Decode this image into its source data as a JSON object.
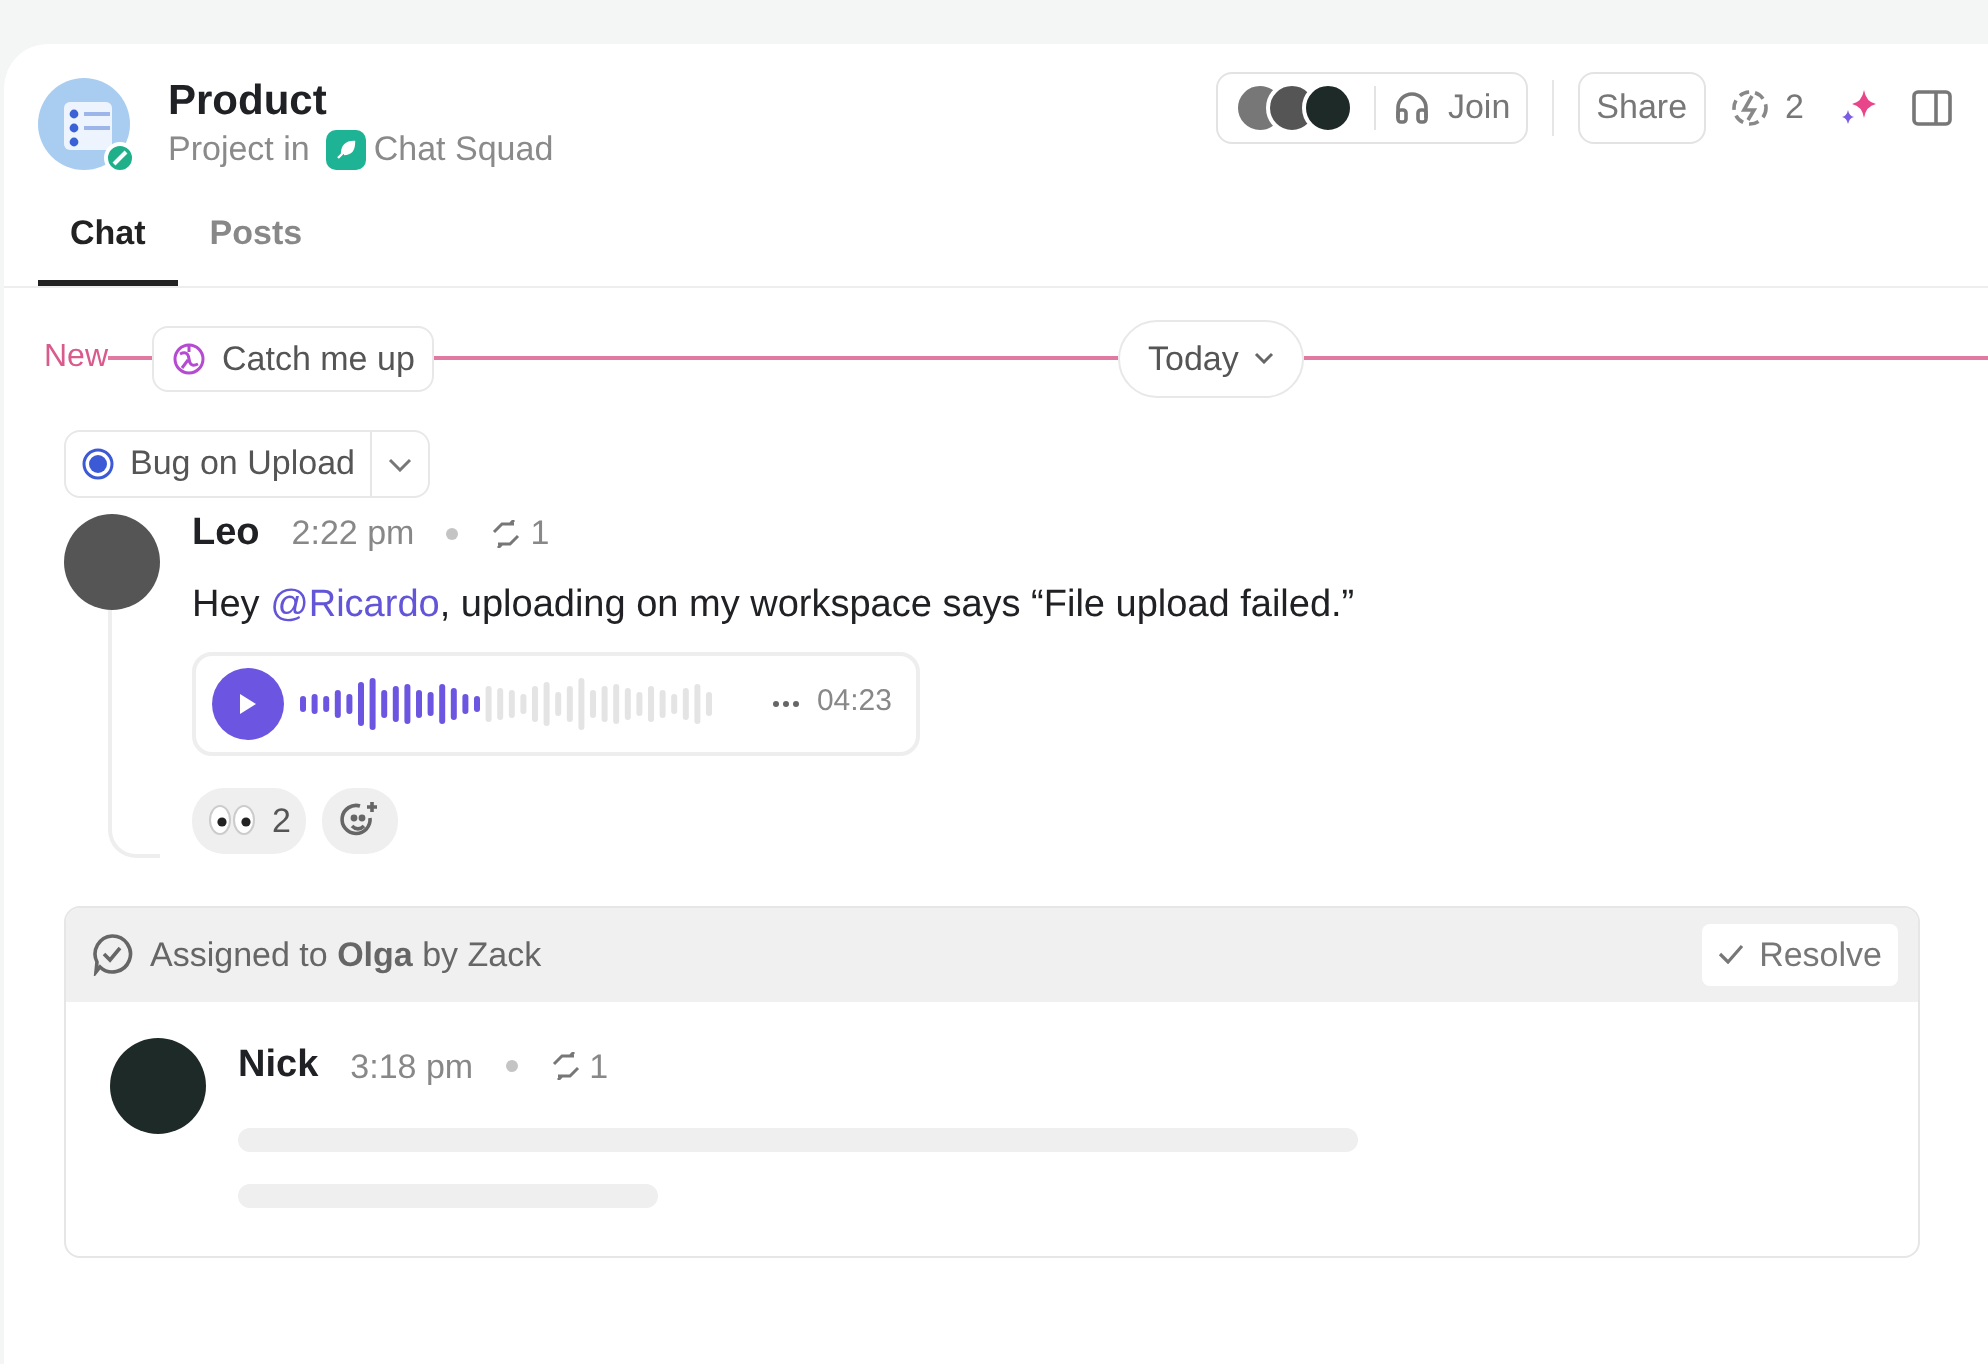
{
  "header": {
    "title": "Product",
    "subtitle": "Project in",
    "space": "Chat Squad"
  },
  "toolbar": {
    "join": "Join",
    "share": "Share",
    "ai_count": "2"
  },
  "tabs": [
    {
      "label": "Chat",
      "selected": true
    },
    {
      "label": "Posts",
      "selected": false
    }
  ],
  "divider": {
    "new": "New",
    "catch_up": "Catch me up",
    "date": "Today"
  },
  "thread": {
    "title": "Bug on Upload"
  },
  "message": {
    "author": "Leo",
    "time": "2:22 pm",
    "replies": "1",
    "text_before": "Hey ",
    "mention": "@Ricardo",
    "text_after": ", uploading on my workspace says “File upload failed.”",
    "audio": {
      "level": 0.45,
      "duration": "04:23"
    },
    "reactions": [
      {
        "count": "2"
      }
    ]
  },
  "assignment": {
    "text": "Assigned to **Olga** by Zack",
    "resolve": "Resolve",
    "reply": {
      "author": "Nick",
      "time": "3:18 pm",
      "replies": "1"
    }
  }
}
